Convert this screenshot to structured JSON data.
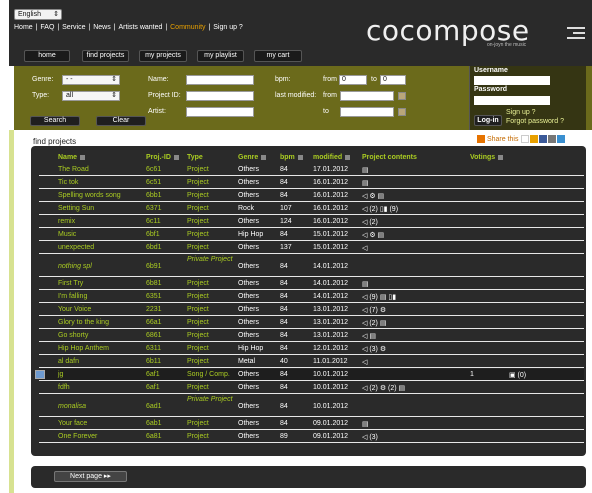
{
  "colors": {
    "accent": "#aacc22",
    "orange": "#e8a000",
    "filter_bg": "#6b6a1b",
    "dark": "#2a2a2a"
  },
  "lang": {
    "value": "English"
  },
  "toplinks": [
    "Home",
    "FAQ",
    "Service",
    "News",
    "Artists wanted",
    "Community",
    "Sign up ?"
  ],
  "toplink_sep": " | ",
  "logo": {
    "text": "cocompose",
    "slogan": "on-joyn the music"
  },
  "mainnav": [
    "home",
    "find projects",
    "my projects",
    "my playlist",
    "my cart"
  ],
  "filter": {
    "genre_label": "Genre:",
    "genre_value": "- -",
    "type_label": "Type:",
    "type_value": "all",
    "name_label": "Name:",
    "projectid_label": "Project ID:",
    "artist_label": "Artist:",
    "bpm_label": "bpm:",
    "from_label": "from",
    "from_value": "0",
    "to_label": "to",
    "to_value": "0",
    "lastmod_label": "last modified:",
    "lastmod_from": "from",
    "lastmod_to": "to",
    "search": "Search",
    "clear": "Clear"
  },
  "login": {
    "username": "Username",
    "password": "Password",
    "login_btn": "Log-in",
    "signup": "Sign up ?",
    "forgot": "Forgot password ?"
  },
  "page_title": "find projects",
  "share": "Share this",
  "columns": {
    "name": "Name",
    "pid": "Proj.-ID",
    "type": "Type",
    "genre": "Genre",
    "bpm": "bpm",
    "modified": "modified",
    "contents": "Project contents",
    "votings": "Votings"
  },
  "rows": [
    {
      "name": "The Road",
      "pid": "6c61",
      "type": "Project",
      "genre": "Others",
      "bpm": "84",
      "modified": "17.01.2012",
      "contents": "▤"
    },
    {
      "name": "Tic tok",
      "pid": "6c51",
      "type": "Project",
      "genre": "Others",
      "bpm": "84",
      "modified": "16.01.2012",
      "contents": "▤"
    },
    {
      "name": "Spelling words song",
      "pid": "6bb1",
      "type": "Project",
      "genre": "Others",
      "bpm": "84",
      "modified": "16.01.2012",
      "contents": "◁ ⚙ ▤"
    },
    {
      "name": "Setting Sun",
      "pid": "6371",
      "type": "Project",
      "genre": "Rock",
      "bpm": "107",
      "modified": "16.01.2012",
      "contents": "◁ (2) ▯▮ (9)"
    },
    {
      "name": "remix",
      "pid": "6c11",
      "type": "Project",
      "genre": "Others",
      "bpm": "124",
      "modified": "16.01.2012",
      "contents": "◁ (2)"
    },
    {
      "name": "Music",
      "pid": "6bf1",
      "type": "Project",
      "genre": "Hip Hop",
      "bpm": "84",
      "modified": "15.01.2012",
      "contents": "◁ ⚙ ▤"
    },
    {
      "name": "unexpected",
      "pid": "6bd1",
      "type": "Project",
      "genre": "Others",
      "bpm": "137",
      "modified": "15.01.2012",
      "contents": "◁"
    },
    {
      "name": "nothing spl",
      "pid": "6b91",
      "type": "Private Project",
      "genre": "Others",
      "bpm": "84",
      "modified": "14.01.2012",
      "contents": "",
      "italic": true,
      "tall": true
    },
    {
      "name": "First Try",
      "pid": "6b81",
      "type": "Project",
      "genre": "Others",
      "bpm": "84",
      "modified": "14.01.2012",
      "contents": "▤"
    },
    {
      "name": "I'm falling",
      "pid": "6351",
      "type": "Project",
      "genre": "Others",
      "bpm": "84",
      "modified": "14.01.2012",
      "contents": "◁ (9) ▤ ▯▮"
    },
    {
      "name": "Your Voice",
      "pid": "2231",
      "type": "Project",
      "genre": "Others",
      "bpm": "84",
      "modified": "13.01.2012",
      "contents": "◁ (7) ⚙"
    },
    {
      "name": "Glory to the king",
      "pid": "66a1",
      "type": "Project",
      "genre": "Others",
      "bpm": "84",
      "modified": "13.01.2012",
      "contents": "◁ (2) ▤"
    },
    {
      "name": "Go shorty",
      "pid": "6861",
      "type": "Project",
      "genre": "Others",
      "bpm": "84",
      "modified": "13.01.2012",
      "contents": "◁ ▤"
    },
    {
      "name": "Hip Hop Anthem",
      "pid": "6311",
      "type": "Project",
      "genre": "Hip Hop",
      "bpm": "84",
      "modified": "12.01.2012",
      "contents": "◁ (3) ⚙"
    },
    {
      "name": "al dafn",
      "pid": "6b11",
      "type": "Project",
      "genre": "Metal",
      "bpm": "40",
      "modified": "11.01.2012",
      "contents": "◁"
    },
    {
      "name": "jg",
      "pid": "6af1",
      "type": "Song / Comp.",
      "genre": "Others",
      "bpm": "84",
      "modified": "10.01.2012",
      "contents": "",
      "votings": "1",
      "extra": "▣ (0)",
      "selected": true
    },
    {
      "name": "fdfh",
      "pid": "6af1",
      "type": "Project",
      "genre": "Others",
      "bpm": "84",
      "modified": "10.01.2012",
      "contents": "◁ (2) ⚙ (2) ▤"
    },
    {
      "name": "monalisa",
      "pid": "6ad1",
      "type": "Private Project",
      "genre": "Others",
      "bpm": "84",
      "modified": "10.01.2012",
      "contents": "",
      "italic": true,
      "tall": true
    },
    {
      "name": "Your face",
      "pid": "6ab1",
      "type": "Project",
      "genre": "Others",
      "bpm": "84",
      "modified": "09.01.2012",
      "contents": "▤"
    },
    {
      "name": "One Forever",
      "pid": "6a81",
      "type": "Project",
      "genre": "Others",
      "bpm": "89",
      "modified": "09.01.2012",
      "contents": "◁ (3)"
    }
  ],
  "next_page": "Next page ▸▸"
}
